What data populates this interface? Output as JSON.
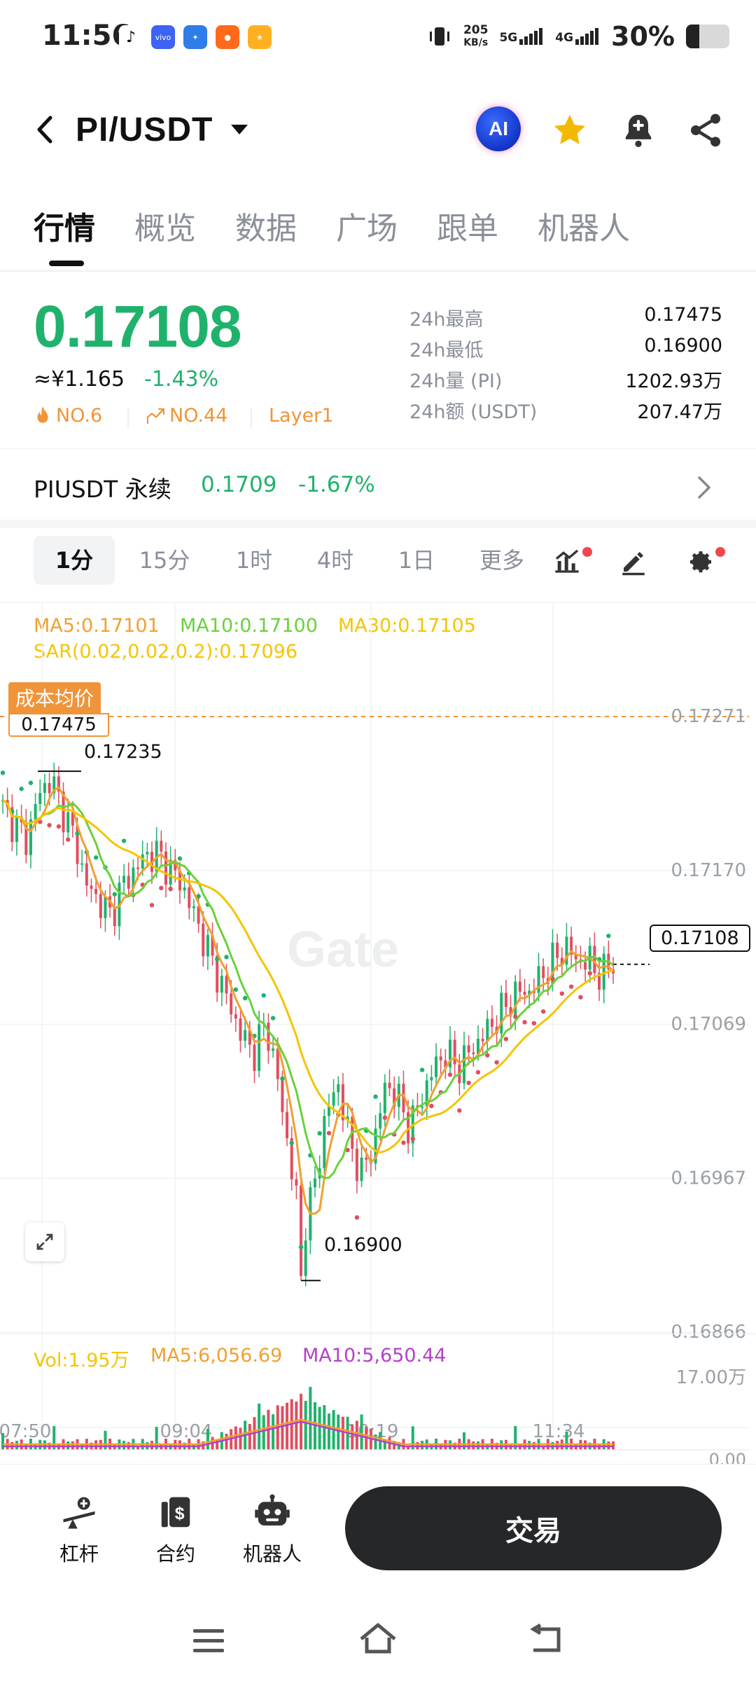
{
  "status_bar": {
    "time": "11:56",
    "net_speed_value": "205",
    "net_speed_unit": "KB/s",
    "sim1": "5G",
    "sim2": "4G",
    "battery_pct": "30%",
    "battery_level": 0.3,
    "app_icons": [
      "tiktok-icon",
      "vivo-icon",
      "bird-app-icon",
      "kuaishou-icon",
      "festival-app-icon"
    ],
    "vivo_label": "vivo"
  },
  "header": {
    "pair": "PI/USDT",
    "ai_label": "AI",
    "accent_star": "#f5b800"
  },
  "tabs": [
    "行情",
    "概览",
    "数据",
    "广场",
    "跟单",
    "机器人"
  ],
  "active_tab": 0,
  "ticker": {
    "price": "0.17108",
    "cny": "≈¥1.165",
    "change": "-1.43%",
    "rank_hot": "NO.6",
    "rank_rise": "NO.44",
    "tag": "Layer1",
    "stats": [
      {
        "label": "24h最高",
        "value": "0.17475"
      },
      {
        "label": "24h最低",
        "value": "0.16900"
      },
      {
        "label": "24h量 (PI)",
        "value": "1202.93万"
      },
      {
        "label": "24h额 (USDT)",
        "value": "207.47万"
      }
    ]
  },
  "perpetual": {
    "name": "PIUSDT 永续",
    "price": "0.1709",
    "change": "-1.67%"
  },
  "timeframes": [
    "1分",
    "15分",
    "1时",
    "4时",
    "1日",
    "更多"
  ],
  "active_timeframe": 0,
  "indicators": {
    "ma5": "MA5:0.17101",
    "ma10": "MA10:0.17100",
    "ma30": "MA30:0.17105",
    "sar": "SAR(0.02,0.02,0.2):0.17096",
    "cost_label": "成本均价",
    "cost_value": "0.17475",
    "high_marker": "0.17235",
    "low_marker": "0.16900",
    "current_price_tag": "0.17108",
    "watermark": "Gate",
    "colors": {
      "up": "#20b26c",
      "down": "#e04f5f",
      "ma5": "#f0a030",
      "ma10": "#6ad13a",
      "ma30": "#f5c400",
      "sar_up": "#20b26c",
      "sar_down": "#e04f5f",
      "vol_ma10": "#b341c8"
    }
  },
  "volume": {
    "vol": "Vol:1.95万",
    "ma5": "MA5:6,056.69",
    "ma10": "MA10:5,650.44",
    "axis_top": "17.00万",
    "axis_bottom": "0.00"
  },
  "chart_data": {
    "type": "candlestick",
    "y_ticks": [
      "0.17271",
      "0.17170",
      "0.17069",
      "0.16967",
      "0.16866"
    ],
    "ylim": [
      0.16866,
      0.17271
    ],
    "x_ticks": [
      "07:50",
      "09:04",
      "10:19",
      "11:34"
    ],
    "close_series": [
      0.1721,
      0.172,
      0.1719,
      0.1722,
      0.1723,
      0.1721,
      0.1719,
      0.1716,
      0.1715,
      0.1714,
      0.1716,
      0.1717,
      0.1718,
      0.1718,
      0.1717,
      0.1716,
      0.1714,
      0.1712,
      0.171,
      0.1708,
      0.1706,
      0.1705,
      0.1707,
      0.1703,
      0.1698,
      0.1693,
      0.1696,
      0.1701,
      0.1703,
      0.1699,
      0.1697,
      0.1699,
      0.1703,
      0.1702,
      0.17,
      0.1702,
      0.1704,
      0.1705,
      0.1704,
      0.1705,
      0.1706,
      0.1707,
      0.1708,
      0.1709,
      0.1709,
      0.171,
      0.1711,
      0.1712,
      0.1711,
      0.1711,
      0.171,
      0.1711
    ],
    "high": 0.17235,
    "low": 0.169,
    "last": 0.17108
  },
  "bottom_bar": {
    "items": [
      {
        "icon": "leverage-icon",
        "label": "杠杆"
      },
      {
        "icon": "contract-icon",
        "label": "合约"
      },
      {
        "icon": "robot-icon",
        "label": "机器人"
      }
    ],
    "trade_label": "交易"
  }
}
